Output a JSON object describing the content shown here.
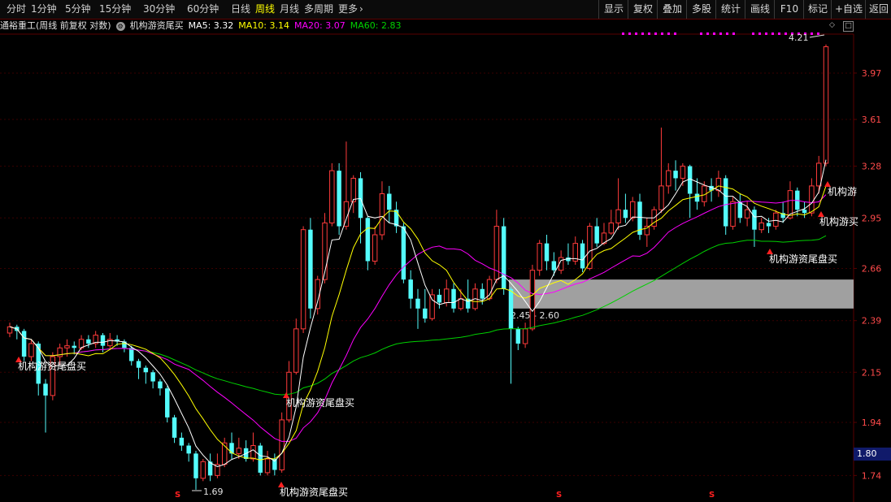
{
  "toolbar": {
    "left_tabs": [
      {
        "label": "分时",
        "active": false
      },
      {
        "label": "1分钟",
        "active": false
      },
      {
        "label": "5分钟",
        "active": false
      },
      {
        "label": "15分钟",
        "active": false
      },
      {
        "label": "30分钟",
        "active": false
      },
      {
        "label": "60分钟",
        "active": false
      },
      {
        "label": "日线",
        "active": false
      },
      {
        "label": "周线",
        "active": true
      },
      {
        "label": "月线",
        "active": false
      },
      {
        "label": "多周期",
        "active": false
      },
      {
        "label": "更多",
        "active": false
      }
    ],
    "right_buttons": [
      "显示",
      "复权",
      "叠加",
      "多股",
      "统计",
      "画线",
      "F10",
      "标记",
      "+自选",
      "返回"
    ]
  },
  "info": {
    "title": "通裕重工(周线 前复权 对数)",
    "indicator": "机构游资尾买",
    "ma5": "MA5: 3.32",
    "ma10": "MA10: 3.14",
    "ma20": "MA20: 3.07",
    "ma60": "MA60: 2.83"
  },
  "colors": {
    "up": "#ff3b3b",
    "down": "#54fcfc",
    "ma5": "#ffffff",
    "ma10": "#ffff00",
    "ma20": "#ff00ff",
    "ma60": "#00d000",
    "axis_text": "#ff4a4a",
    "signal": "#ff2020"
  },
  "current_price": "1.80",
  "chart_data": {
    "type": "candlestick",
    "scale": "log",
    "y_ticks": [
      3.97,
      3.61,
      3.28,
      2.95,
      2.66,
      2.39,
      2.15,
      1.94,
      1.74
    ],
    "ylim": [
      1.67,
      4.3
    ],
    "annotations": {
      "high_label": "4.21",
      "low_label": "1.69",
      "zone_label": "2.45 - 2.60",
      "zone": [
        2.45,
        2.6
      ]
    },
    "signal_label": "机构游资尾盘买",
    "signal_label_short1": "机构游",
    "signal_label_short2": "机构游买",
    "candles": [
      [
        2.33,
        2.36,
        2.38,
        2.31
      ],
      [
        2.36,
        2.34,
        2.37,
        2.3
      ],
      [
        2.34,
        2.22,
        2.35,
        2.2
      ],
      [
        2.22,
        2.28,
        2.3,
        2.2
      ],
      [
        2.28,
        2.1,
        2.29,
        2.05
      ],
      [
        2.1,
        2.05,
        2.12,
        1.9
      ],
      [
        2.05,
        2.22,
        2.24,
        2.03
      ],
      [
        2.22,
        2.26,
        2.28,
        2.18
      ],
      [
        2.26,
        2.27,
        2.3,
        2.22
      ],
      [
        2.27,
        2.26,
        2.29,
        2.23
      ],
      [
        2.26,
        2.3,
        2.32,
        2.25
      ],
      [
        2.3,
        2.28,
        2.32,
        2.26
      ],
      [
        2.28,
        2.32,
        2.34,
        2.26
      ],
      [
        2.32,
        2.27,
        2.33,
        2.24
      ],
      [
        2.27,
        2.3,
        2.33,
        2.25
      ],
      [
        2.3,
        2.29,
        2.32,
        2.27
      ],
      [
        2.29,
        2.26,
        2.3,
        2.24
      ],
      [
        2.26,
        2.2,
        2.27,
        2.18
      ],
      [
        2.2,
        2.17,
        2.21,
        2.12
      ],
      [
        2.17,
        2.15,
        2.18,
        2.1
      ],
      [
        2.15,
        2.11,
        2.16,
        2.08
      ],
      [
        2.11,
        2.08,
        2.12,
        2.05
      ],
      [
        2.08,
        1.96,
        2.09,
        1.94
      ],
      [
        1.96,
        1.88,
        1.97,
        1.86
      ],
      [
        1.88,
        1.85,
        1.9,
        1.83
      ],
      [
        1.85,
        1.82,
        1.86,
        1.79
      ],
      [
        1.82,
        1.73,
        1.83,
        1.69
      ],
      [
        1.73,
        1.79,
        1.8,
        1.72
      ],
      [
        1.79,
        1.74,
        1.82,
        1.72
      ],
      [
        1.74,
        1.78,
        1.82,
        1.73
      ],
      [
        1.78,
        1.86,
        1.88,
        1.77
      ],
      [
        1.86,
        1.82,
        1.9,
        1.8
      ],
      [
        1.82,
        1.84,
        1.88,
        1.8
      ],
      [
        1.84,
        1.8,
        1.87,
        1.79
      ],
      [
        1.8,
        1.85,
        1.9,
        1.79
      ],
      [
        1.85,
        1.75,
        1.86,
        1.74
      ],
      [
        1.75,
        1.8,
        1.83,
        1.74
      ],
      [
        1.8,
        1.76,
        1.82,
        1.74
      ],
      [
        1.76,
        1.95,
        1.98,
        1.75
      ],
      [
        1.95,
        2.15,
        2.2,
        1.94
      ],
      [
        2.15,
        2.35,
        2.4,
        2.14
      ],
      [
        2.35,
        2.88,
        2.9,
        2.33
      ],
      [
        2.88,
        2.45,
        2.95,
        2.4
      ],
      [
        2.45,
        2.6,
        2.62,
        2.42
      ],
      [
        2.6,
        2.92,
        2.98,
        2.58
      ],
      [
        2.92,
        3.25,
        3.3,
        2.9
      ],
      [
        3.25,
        2.9,
        3.3,
        2.85
      ],
      [
        2.9,
        3.05,
        3.45,
        2.88
      ],
      [
        3.05,
        3.2,
        3.22,
        2.98
      ],
      [
        3.2,
        2.95,
        3.24,
        2.8
      ],
      [
        2.95,
        2.7,
        2.96,
        2.65
      ],
      [
        2.7,
        2.85,
        2.9,
        2.68
      ],
      [
        2.85,
        3.1,
        3.18,
        2.82
      ],
      [
        3.1,
        3.0,
        3.15,
        2.92
      ],
      [
        3.0,
        2.9,
        3.05,
        2.86
      ],
      [
        2.9,
        2.6,
        2.92,
        2.58
      ],
      [
        2.6,
        2.5,
        2.65,
        2.45
      ],
      [
        2.5,
        2.45,
        2.55,
        2.35
      ],
      [
        2.45,
        2.4,
        2.55,
        2.38
      ],
      [
        2.4,
        2.52,
        2.55,
        2.39
      ],
      [
        2.52,
        2.48,
        2.55,
        2.45
      ],
      [
        2.48,
        2.55,
        2.6,
        2.46
      ],
      [
        2.55,
        2.45,
        2.58,
        2.43
      ],
      [
        2.45,
        2.5,
        2.55,
        2.44
      ],
      [
        2.5,
        2.45,
        2.6,
        2.43
      ],
      [
        2.45,
        2.55,
        2.58,
        2.44
      ],
      [
        2.55,
        2.5,
        2.58,
        2.47
      ],
      [
        2.5,
        2.6,
        2.62,
        2.49
      ],
      [
        2.6,
        2.9,
        3.0,
        2.58
      ],
      [
        2.9,
        2.55,
        2.95,
        2.52
      ],
      [
        2.55,
        2.35,
        2.56,
        2.1
      ],
      [
        2.35,
        2.28,
        2.36,
        2.25
      ],
      [
        2.28,
        2.35,
        2.38,
        2.26
      ],
      [
        2.35,
        2.65,
        2.68,
        2.34
      ],
      [
        2.65,
        2.8,
        2.82,
        2.62
      ],
      [
        2.8,
        2.7,
        2.85,
        2.65
      ],
      [
        2.7,
        2.65,
        2.75,
        2.62
      ],
      [
        2.65,
        2.72,
        2.76,
        2.63
      ],
      [
        2.72,
        2.7,
        2.8,
        2.68
      ],
      [
        2.7,
        2.8,
        2.84,
        2.68
      ],
      [
        2.8,
        2.66,
        2.82,
        2.64
      ],
      [
        2.66,
        2.9,
        2.92,
        2.65
      ],
      [
        2.9,
        2.8,
        2.95,
        2.78
      ],
      [
        2.8,
        2.86,
        2.92,
        2.79
      ],
      [
        2.86,
        2.92,
        3.0,
        2.85
      ],
      [
        2.92,
        3.0,
        3.2,
        2.88
      ],
      [
        3.0,
        2.95,
        3.1,
        2.92
      ],
      [
        2.95,
        3.05,
        3.08,
        2.93
      ],
      [
        3.05,
        2.85,
        3.1,
        2.82
      ],
      [
        2.85,
        2.9,
        2.95,
        2.78
      ],
      [
        2.9,
        3.0,
        3.02,
        2.88
      ],
      [
        3.0,
        3.15,
        3.55,
        2.98
      ],
      [
        3.15,
        3.25,
        3.3,
        3.1
      ],
      [
        3.25,
        3.2,
        3.32,
        3.12
      ],
      [
        3.2,
        3.28,
        3.3,
        3.15
      ],
      [
        3.28,
        3.1,
        3.29,
        2.95
      ],
      [
        3.1,
        3.05,
        3.2,
        3.0
      ],
      [
        3.05,
        3.15,
        3.18,
        3.02
      ],
      [
        3.15,
        3.12,
        3.2,
        3.05
      ],
      [
        3.12,
        3.2,
        3.25,
        3.08
      ],
      [
        3.2,
        2.9,
        3.22,
        2.85
      ],
      [
        2.9,
        3.05,
        3.08,
        2.88
      ],
      [
        3.05,
        2.95,
        3.1,
        2.92
      ],
      [
        2.95,
        3.0,
        3.05,
        2.9
      ],
      [
        3.0,
        2.88,
        3.02,
        2.78
      ],
      [
        2.88,
        2.92,
        2.95,
        2.86
      ],
      [
        2.92,
        2.9,
        2.95,
        2.86
      ],
      [
        2.9,
        2.98,
        3.0,
        2.88
      ],
      [
        2.98,
        2.95,
        3.05,
        2.92
      ],
      [
        2.95,
        3.12,
        3.18,
        2.94
      ],
      [
        3.12,
        3.0,
        3.14,
        2.96
      ],
      [
        3.0,
        2.98,
        3.05,
        2.95
      ],
      [
        2.98,
        3.15,
        3.2,
        2.96
      ],
      [
        3.15,
        3.3,
        3.35,
        3.1
      ],
      [
        3.3,
        4.19,
        4.21,
        3.28
      ]
    ]
  }
}
